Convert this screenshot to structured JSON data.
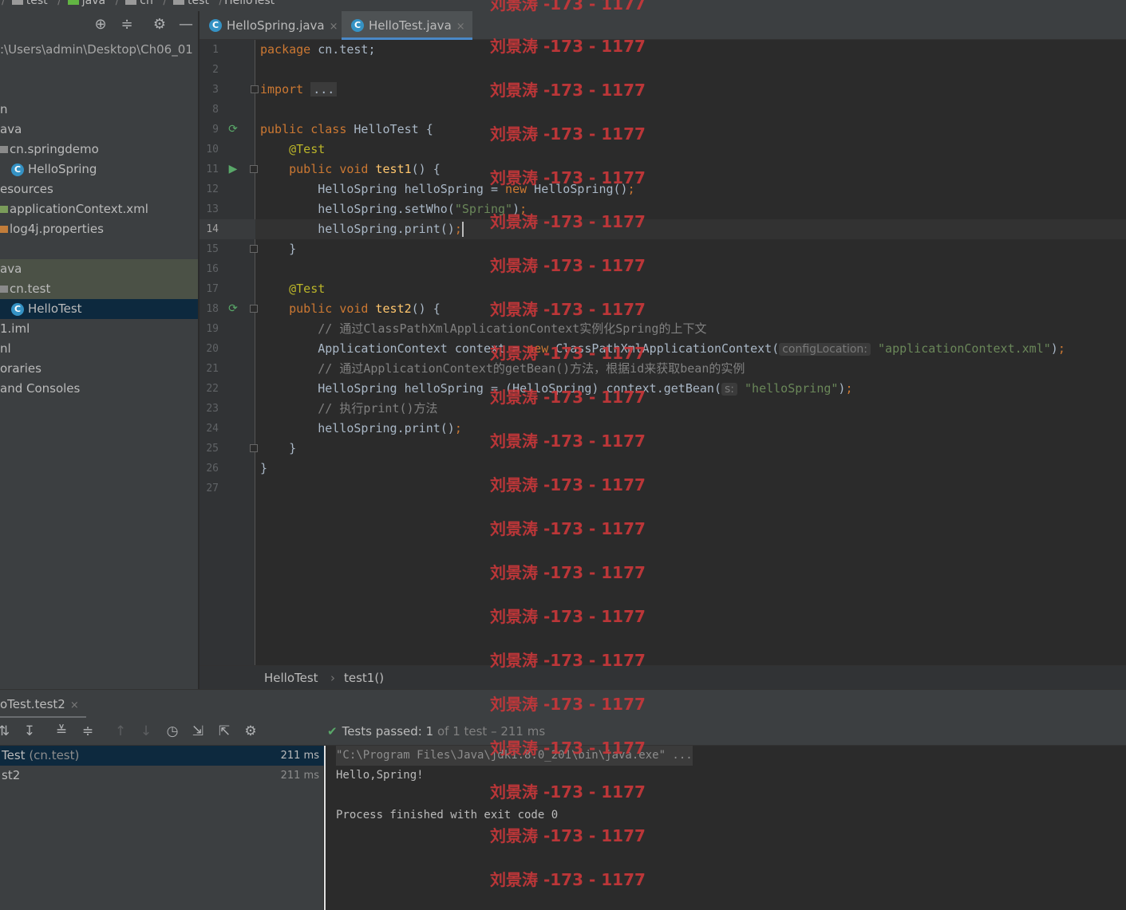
{
  "breadcrumb": {
    "items": [
      "test",
      "java",
      "cn",
      "test",
      "HelloTest"
    ]
  },
  "project": {
    "path_fragment": ":\\Users\\admin\\Desktop\\Ch06_01",
    "rows": [
      {
        "label": "n"
      },
      {
        "label": "ava"
      },
      {
        "label": "cn.springdemo"
      },
      {
        "label": "HelloSpring"
      },
      {
        "label": "esources"
      },
      {
        "label": "applicationContext.xml"
      },
      {
        "label": "log4j.properties"
      },
      {
        "label": "ava"
      },
      {
        "label": "cn.test"
      },
      {
        "label": "HelloTest"
      },
      {
        "label": "1.iml"
      },
      {
        "label": "nl"
      },
      {
        "label": "oraries"
      },
      {
        "label": "and Consoles"
      }
    ]
  },
  "editor": {
    "tabs": [
      {
        "label": "HelloSpring.java",
        "close": "×"
      },
      {
        "label": "HelloTest.java",
        "close": "×"
      }
    ],
    "line_numbers": [
      "1",
      "2",
      "3",
      "8",
      "9",
      "10",
      "11",
      "12",
      "13",
      "14",
      "15",
      "16",
      "17",
      "18",
      "19",
      "20",
      "21",
      "22",
      "23",
      "24",
      "25",
      "26",
      "27"
    ],
    "code": {
      "l1_kw": "package",
      "l1_rest": " cn.test;",
      "l3_kw": "import",
      "l3_fold": "...",
      "l9_kw": "public class",
      "l9_rest": " HelloTest {",
      "l10_ann": "    @Test",
      "l11_kw": "    public void ",
      "l11_fn": "test1",
      "l11_rest": "() {",
      "l12_a": "        HelloSpring helloSpring = ",
      "l12_kw": "new",
      "l12_b": " HelloSpring()",
      "l12_semi": ";",
      "l13_a": "        helloSpring.setWho(",
      "l13_str": "\"Spring\"",
      "l13_b": ")",
      "l13_semi": ";",
      "l14_a": "        helloSpring.print()",
      "l14_semi": ";",
      "l15": "    }",
      "l17_ann": "    @Test",
      "l18_kw": "    public void ",
      "l18_fn": "test2",
      "l18_rest": "() {",
      "l19_cmt": "        // 通过ClassPathXmlApplicationContext实例化Spring的上下文",
      "l20_a": "        ApplicationContext context = ",
      "l20_kw": "new",
      "l20_b": " ClassPathXmlApplicationContext(",
      "l20_hint": "configLocation:",
      "l20_str": "\"applicationContext.xml\"",
      "l20_c": ")",
      "l20_semi": ";",
      "l21_cmt": "        // 通过ApplicationContext的getBean()方法，根据id来获取bean的实例",
      "l22_a": "        HelloSpring helloSpring = (HelloSpring) context.getBean(",
      "l22_hint": "s:",
      "l22_str": "\"helloSpring\"",
      "l22_c": ")",
      "l22_semi": ";",
      "l23_cmt": "        // 执行print()方法",
      "l24_a": "        helloSpring.print()",
      "l24_semi": ";",
      "l25": "    }",
      "l26": "}"
    },
    "crumbs": {
      "class": "HelloTest",
      "sep": "›",
      "method": "test1()"
    }
  },
  "run": {
    "tab_label": "oTest.test2",
    "tab_close": "×",
    "status": {
      "passed": "Tests passed:",
      "count": "1",
      "rest": "of 1 test – 211 ms"
    },
    "tree": [
      {
        "name": "Test",
        "pkg": "(cn.test)",
        "time": "211 ms"
      },
      {
        "name": "st2",
        "pkg": "",
        "time": "211 ms"
      }
    ],
    "console": [
      "\"C:\\Program Files\\Java\\jdk1.8.0_201\\bin\\java.exe\" ...",
      "Hello,Spring!",
      "",
      "Process finished with exit code 0"
    ]
  },
  "watermark": {
    "text": "刘景涛 -173 - 1177"
  },
  "colors": {
    "accent": "#4a88c7",
    "selection": "#0d293e",
    "watermark": "#c8373a",
    "pass_green": "#59a869"
  }
}
